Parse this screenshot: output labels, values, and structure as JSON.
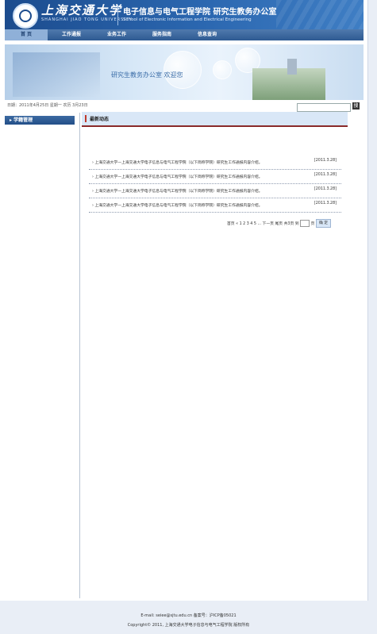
{
  "header": {
    "university_cn": "上海交通大学",
    "university_en": "SHANGHAI JIAO TONG UNIVERSITY",
    "school_title": "电子信息与电气工程学院  研究生教务办公室",
    "school_en": "School of Electronic Information and Electrical Engineering"
  },
  "nav": {
    "items": [
      "首 页",
      "工作通报",
      "业务工作",
      "服务指南",
      "信息查询"
    ]
  },
  "banner": {
    "welcome": "研究生教务办公室  欢迎您"
  },
  "datebar": {
    "text": "日期：2011年4月25日  星期一  农历 3月23日"
  },
  "search": {
    "button": "搜"
  },
  "sidebar": {
    "heading": "▸ 学籍管理"
  },
  "main": {
    "heading": "最新动态",
    "news": [
      {
        "title": "› 上海交通大学—上海交通大学电子信息与电气工程学院（以下简称学院）研究生工作通报内容介绍。",
        "date": "[2011.3.28]"
      },
      {
        "title": "› 上海交通大学—上海交通大学电子信息与电气工程学院（以下简称学院）研究生工作通报内容介绍。",
        "date": "[2011.3.28]"
      },
      {
        "title": "› 上海交通大学—上海交通大学电子信息与电气工程学院（以下简称学院）研究生工作通报内容介绍。",
        "date": "[2011.3.28]"
      },
      {
        "title": "› 上海交通大学—上海交通大学电子信息与电气工程学院（以下简称学院）研究生工作通报内容介绍。",
        "date": "[2011.3.28]"
      }
    ],
    "pager": {
      "prefix": "首页 « 1 2 3 4 5 ... 下一页 尾页 共3页 到",
      "suffix": "页",
      "go": "确 定"
    }
  },
  "footer": {
    "line1": "E-mail: seiee@sjtu.edu.cn  备案号：沪ICP备05021",
    "line2": "Copyright© 2011, 上海交通大学电子信息与电气工程学院 版权所有"
  },
  "colors": {
    "header": "#2b67b0",
    "nav": "#2e5a92",
    "accent_red": "#8a2a2a"
  }
}
